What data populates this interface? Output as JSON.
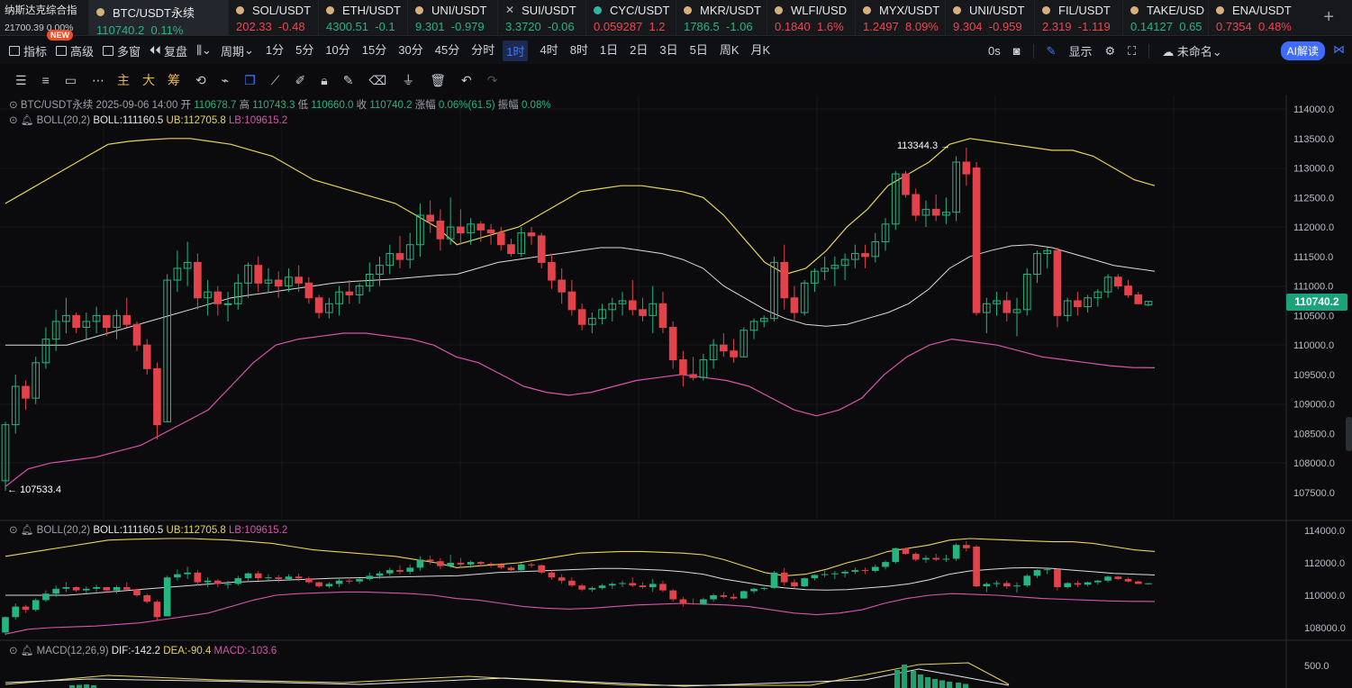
{
  "index_tab": {
    "name": "纳斯达克综合指",
    "value": "21700.39",
    "change": "0.00%",
    "badge": "NEW"
  },
  "tickers": [
    {
      "sym": "BTC/USDT永续",
      "price": "110740.2",
      "chg": "0.11%",
      "dir": "up",
      "icon": "bitcoin-icon"
    },
    {
      "sym": "SOL/USDT",
      "price": "202.33",
      "chg": "-0.48",
      "dir": "dn",
      "icon": "coin-icon"
    },
    {
      "sym": "ETH/USDT",
      "price": "4300.51",
      "chg": "-0.1",
      "dir": "up",
      "icon": "coin-icon"
    },
    {
      "sym": "UNI/USDT",
      "price": "9.301",
      "chg": "-0.979",
      "dir": "up",
      "icon": "coin-icon"
    },
    {
      "sym": "SUI/USDT",
      "price": "3.3720",
      "chg": "-0.06",
      "dir": "up",
      "icon": "close-icon"
    },
    {
      "sym": "CYC/USDT",
      "price": "0.059287",
      "chg": "1.2",
      "dir": "dn",
      "icon": "coin-icon"
    },
    {
      "sym": "MKR/USDT",
      "price": "1786.5",
      "chg": "-1.06",
      "dir": "up",
      "icon": "coin-icon"
    },
    {
      "sym": "WLFI/USD",
      "price": "0.1840",
      "chg": "1.6%",
      "dir": "dn",
      "icon": "coin-icon"
    },
    {
      "sym": "MYX/USDT",
      "price": "1.2497",
      "chg": "8.09%",
      "dir": "dn",
      "icon": "coin-icon"
    },
    {
      "sym": "UNI/USDT",
      "price": "9.304",
      "chg": "-0.959",
      "dir": "dn",
      "icon": "coin-icon"
    },
    {
      "sym": "FIL/USDT",
      "price": "2.319",
      "chg": "-1.119",
      "dir": "dn",
      "icon": "coin-icon"
    },
    {
      "sym": "TAKE/USD",
      "price": "0.14127",
      "chg": "0.65",
      "dir": "up",
      "icon": "coin-icon"
    },
    {
      "sym": "ENA/USDT",
      "price": "0.7354",
      "chg": "0.48%",
      "dir": "dn",
      "icon": "coin-icon"
    }
  ],
  "toolbar": {
    "indicators": "指标",
    "advanced": "高级",
    "multi": "多窗",
    "replay": "复盘",
    "period": "周期",
    "periods": [
      "1分",
      "5分",
      "10分",
      "15分",
      "30分",
      "45分",
      "分时",
      "1时",
      "4时",
      "8时",
      "1日",
      "2日",
      "3日",
      "5日",
      "周K",
      "月K"
    ],
    "selected_period": "1时",
    "timer": "0s",
    "display": "显示",
    "layout": "未命名",
    "ai": "AI解读"
  },
  "drawbar": {
    "main": "主",
    "big": "大",
    "chip": "筹"
  },
  "info": {
    "symbol": "BTC/USDT永续",
    "datetime": "2025-09-06 14:00",
    "open_k": "开",
    "open": "110678.7",
    "high_k": "高",
    "high": "110743.3",
    "low_k": "低",
    "low": "110660.0",
    "close_k": "收",
    "close": "110740.2",
    "chg_k": "涨幅",
    "chg": "0.06%(61.5)",
    "amp_k": "振幅",
    "amp": "0.08%"
  },
  "boll": {
    "name": "BOLL(20,2)",
    "mid": "BOLL:111160.5",
    "ub": "UB:112705.8",
    "lb": "LB:109615.2"
  },
  "macd": {
    "name": "MACD(12,26,9)",
    "dif": "DIF:-142.2",
    "dea": "DEA:-90.4",
    "macd": "MACD:-103.6"
  },
  "main_axis": [
    "114000.0",
    "113500.0",
    "113000.0",
    "112500.0",
    "112000.0",
    "111500.0",
    "111000.0",
    "110500.0",
    "110000.0",
    "109500.0",
    "109000.0",
    "108500.0",
    "108000.0",
    "107500.0"
  ],
  "sub_axis": [
    "114000.0",
    "112000.0",
    "110000.0",
    "108000.0"
  ],
  "macd_axis": [
    "500.0"
  ],
  "high_marker": "113344.3",
  "low_marker": "107533.4",
  "last_price": "110740.2",
  "colors": {
    "up": "#25b580",
    "down": "#e2434b",
    "boll_mid": "#dcdcdc",
    "boll_ub": "#e6d35a",
    "boll_lb": "#d655a8",
    "accent": "#3d7bff"
  },
  "chart_data": {
    "type": "candlestick",
    "candles": [
      [
        107700,
        108700,
        107533,
        108650
      ],
      [
        108650,
        109500,
        108500,
        109300
      ],
      [
        109300,
        109400,
        108900,
        109100
      ],
      [
        109100,
        109800,
        109000,
        109700
      ],
      [
        109700,
        110300,
        109600,
        110100
      ],
      [
        110100,
        110600,
        109900,
        110400
      ],
      [
        110400,
        110800,
        110200,
        110500
      ],
      [
        110500,
        110550,
        110200,
        110300
      ],
      [
        110300,
        110550,
        110100,
        110400
      ],
      [
        110400,
        110650,
        110200,
        110500
      ],
      [
        110500,
        110500,
        110150,
        110300
      ],
      [
        110300,
        110600,
        110100,
        110500
      ],
      [
        110500,
        110800,
        110300,
        110350
      ],
      [
        110350,
        110400,
        109900,
        110000
      ],
      [
        110000,
        110100,
        109500,
        109600
      ],
      [
        109600,
        109700,
        108400,
        108650
      ],
      [
        108700,
        111200,
        108700,
        111100
      ],
      [
        111100,
        111600,
        110900,
        111300
      ],
      [
        111300,
        111750,
        111000,
        111400
      ],
      [
        111400,
        111550,
        110600,
        110800
      ],
      [
        110800,
        111100,
        110500,
        110900
      ],
      [
        110900,
        111000,
        110500,
        110700
      ],
      [
        110700,
        110900,
        110400,
        110700
      ],
      [
        110700,
        111200,
        110600,
        111050
      ],
      [
        111050,
        111400,
        110800,
        111350
      ],
      [
        111350,
        111500,
        110900,
        111050
      ],
      [
        111050,
        111300,
        110900,
        111100
      ],
      [
        111100,
        111250,
        110800,
        111000
      ],
      [
        111000,
        111300,
        110900,
        111150
      ],
      [
        111150,
        111350,
        110900,
        111050
      ],
      [
        111050,
        111150,
        110700,
        110800
      ],
      [
        110800,
        110850,
        110450,
        110550
      ],
      [
        110550,
        110800,
        110450,
        110700
      ],
      [
        110700,
        111000,
        110500,
        110900
      ],
      [
        110900,
        111100,
        110700,
        110850
      ],
      [
        110850,
        111050,
        110700,
        111000
      ],
      [
        111000,
        111400,
        110900,
        111200
      ],
      [
        111200,
        111500,
        111000,
        111350
      ],
      [
        111350,
        111700,
        111200,
        111550
      ],
      [
        111550,
        111850,
        111300,
        111450
      ],
      [
        111450,
        111900,
        111300,
        111700
      ],
      [
        111700,
        112400,
        111500,
        112200
      ],
      [
        112200,
        112450,
        111900,
        112100
      ],
      [
        112100,
        112300,
        111600,
        111800
      ],
      [
        111800,
        112500,
        111700,
        112000
      ],
      [
        112000,
        112300,
        111700,
        111900
      ],
      [
        111900,
        112150,
        111700,
        112050
      ],
      [
        112050,
        112100,
        111750,
        111950
      ],
      [
        111950,
        112050,
        111700,
        111900
      ],
      [
        111900,
        112000,
        111600,
        111700
      ],
      [
        111700,
        111800,
        111500,
        111550
      ],
      [
        111550,
        112000,
        111500,
        111900
      ],
      [
        111900,
        112000,
        111700,
        111850
      ],
      [
        111850,
        111900,
        111300,
        111400
      ],
      [
        111400,
        111550,
        110950,
        111100
      ],
      [
        111100,
        111300,
        110700,
        110900
      ],
      [
        110900,
        111100,
        110500,
        110600
      ],
      [
        110600,
        110700,
        110250,
        110350
      ],
      [
        110350,
        110550,
        110200,
        110450
      ],
      [
        110450,
        110700,
        110350,
        110600
      ],
      [
        110600,
        110800,
        110400,
        110700
      ],
      [
        110700,
        110900,
        110500,
        110750
      ],
      [
        110750,
        111100,
        110500,
        110600
      ],
      [
        110600,
        110800,
        110400,
        110500
      ],
      [
        110500,
        111000,
        110200,
        110700
      ],
      [
        110700,
        110900,
        110200,
        110300
      ],
      [
        110300,
        110400,
        109600,
        109750
      ],
      [
        109750,
        109900,
        109300,
        109500
      ],
      [
        109500,
        109800,
        109400,
        109450
      ],
      [
        109450,
        109850,
        109400,
        109750
      ],
      [
        109750,
        110100,
        109600,
        110000
      ],
      [
        110000,
        110200,
        109800,
        109900
      ],
      [
        109900,
        110100,
        109700,
        109800
      ],
      [
        109800,
        110300,
        109800,
        110250
      ],
      [
        110250,
        110450,
        110100,
        110400
      ],
      [
        110400,
        110500,
        110300,
        110450
      ],
      [
        110450,
        111500,
        110400,
        111400
      ],
      [
        111400,
        111700,
        110600,
        110800
      ],
      [
        110800,
        111000,
        110400,
        110550
      ],
      [
        110550,
        111100,
        110500,
        111050
      ],
      [
        111050,
        111300,
        110900,
        111250
      ],
      [
        111250,
        111500,
        111100,
        111300
      ],
      [
        111300,
        111500,
        111000,
        111350
      ],
      [
        111350,
        111550,
        111100,
        111450
      ],
      [
        111450,
        111700,
        111300,
        111550
      ],
      [
        111550,
        111700,
        111300,
        111500
      ],
      [
        111500,
        111900,
        111400,
        111750
      ],
      [
        111750,
        112150,
        111600,
        112050
      ],
      [
        112050,
        112950,
        111950,
        112900
      ],
      [
        112900,
        112950,
        112500,
        112550
      ],
      [
        112550,
        112650,
        112100,
        112200
      ],
      [
        112200,
        112450,
        112000,
        112300
      ],
      [
        112300,
        112550,
        112100,
        112200
      ],
      [
        112200,
        112500,
        112050,
        112250
      ],
      [
        112250,
        113200,
        112100,
        113100
      ],
      [
        113100,
        113344,
        112700,
        112900
      ],
      [
        113000,
        113100,
        110500,
        110550
      ],
      [
        110550,
        110800,
        110200,
        110700
      ],
      [
        110700,
        110900,
        110500,
        110750
      ],
      [
        110750,
        110900,
        110400,
        110550
      ],
      [
        110550,
        110800,
        110150,
        110600
      ],
      [
        110600,
        111300,
        110500,
        111200
      ],
      [
        111200,
        111600,
        111050,
        111550
      ],
      [
        111550,
        111650,
        111300,
        111600
      ],
      [
        111600,
        111650,
        110300,
        110500
      ],
      [
        110500,
        110800,
        110400,
        110750
      ],
      [
        110750,
        110900,
        110500,
        110650
      ],
      [
        110650,
        110850,
        110550,
        110800
      ],
      [
        110800,
        110950,
        110650,
        110900
      ],
      [
        110900,
        111200,
        110800,
        111150
      ],
      [
        111150,
        111200,
        110950,
        111000
      ],
      [
        111000,
        111100,
        110800,
        110850
      ],
      [
        110850,
        110900,
        110700,
        110700
      ],
      [
        110680,
        110743,
        110660,
        110740
      ]
    ],
    "boll_mid": [
      110000,
      110000,
      110000,
      110000,
      110100,
      110200,
      110300,
      110400,
      110500,
      110600,
      110700,
      110800,
      110850,
      110900,
      110950,
      111000,
      111050,
      111080,
      111100,
      111120,
      111150,
      111180,
      111200,
      111300,
      111400,
      111450,
      111500,
      111550,
      111600,
      111650,
      111650,
      111600,
      111550,
      111450,
      111300,
      111000,
      110800,
      110600,
      110450,
      110350,
      110320,
      110350,
      110450,
      110550,
      110700,
      110950,
      111300,
      111500,
      111600,
      111680,
      111700,
      111650,
      111550,
      111450,
      111350,
      111300,
      111250
    ],
    "boll_ub": [
      112400,
      112600,
      112800,
      113000,
      113200,
      113400,
      113450,
      113480,
      113500,
      113500,
      113450,
      113400,
      113300,
      113200,
      113000,
      112800,
      112700,
      112600,
      112500,
      112400,
      112200,
      112000,
      111700,
      111800,
      111900,
      112000,
      112200,
      112400,
      112600,
      112650,
      112700,
      112700,
      112650,
      112600,
      112500,
      112200,
      111800,
      111400,
      111200,
      111300,
      111600,
      112000,
      112300,
      112700,
      112900,
      113100,
      113400,
      113500,
      113450,
      113400,
      113350,
      113300,
      113300,
      113200,
      113000,
      112800,
      112700
    ],
    "boll_lb": [
      107600,
      107900,
      108000,
      108050,
      108100,
      108200,
      108300,
      108500,
      108700,
      108900,
      109300,
      109700,
      110000,
      110100,
      110150,
      110200,
      110200,
      110150,
      110100,
      110000,
      109800,
      109700,
      109500,
      109300,
      109200,
      109150,
      109200,
      109300,
      109400,
      109450,
      109500,
      109450,
      109400,
      109300,
      109100,
      108900,
      108800,
      108900,
      109100,
      109500,
      109800,
      110000,
      110100,
      110050,
      110000,
      109900,
      109800,
      109750,
      109700,
      109650,
      109620,
      109615
    ]
  }
}
